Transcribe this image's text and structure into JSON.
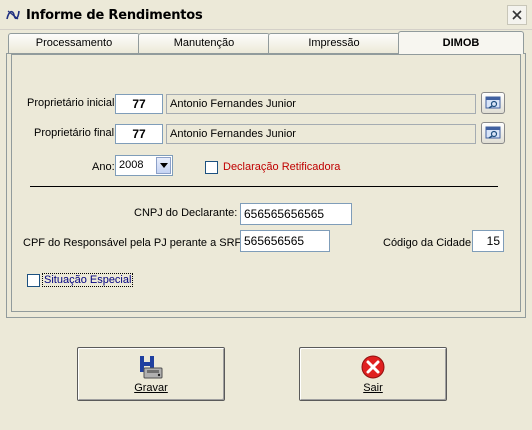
{
  "window": {
    "title": "Informe de Rendimentos",
    "icon": "app-icon",
    "close": "close-icon"
  },
  "tabs": [
    {
      "label": "Processamento",
      "active": false
    },
    {
      "label": "Manutenção",
      "active": false
    },
    {
      "label": "Impressão",
      "active": false
    },
    {
      "label": "DIMOB",
      "active": true
    }
  ],
  "form": {
    "proprietario_inicial": {
      "label": "Proprietário inicial:",
      "code": "77",
      "name": "Antonio Fernandes Junior"
    },
    "proprietario_final": {
      "label": "Proprietário final:",
      "code": "77",
      "name": "Antonio Fernandes Junior"
    },
    "ano": {
      "label": "Ano:",
      "value": "2008"
    },
    "retificadora": {
      "label": "Declaração Retificadora",
      "checked": false,
      "color": "#c00000"
    },
    "cnpj": {
      "label": "CNPJ do Declarante:",
      "value": "656565656565"
    },
    "cpf": {
      "label": "CPF do Responsável pela PJ perante a SRF:",
      "value": "565656565"
    },
    "codigo_cidade": {
      "label": "Código da Cidade:",
      "value": "15"
    },
    "situacao_especial": {
      "label": "Situação Especial",
      "checked": false,
      "color": "#000080"
    }
  },
  "buttons": {
    "gravar": {
      "label": "Gravar",
      "icon": "save-icon"
    },
    "sair": {
      "label": "Sair",
      "icon": "exit-icon"
    }
  }
}
